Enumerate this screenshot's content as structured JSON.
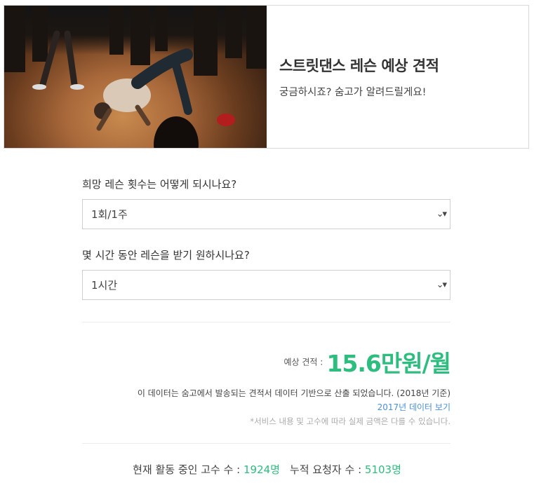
{
  "hero": {
    "title": "스트릿댄스 레슨 예상 견적",
    "subtitle": "궁금하시죠? 숨고가 알려드릴게요!"
  },
  "questions": [
    {
      "label": "희망 레슨 횟수는 어떻게 되시나요?",
      "selected": "1회/1주"
    },
    {
      "label": "몇 시간 동안 레슨을 받기 원하시나요?",
      "selected": "1시간"
    }
  ],
  "estimate": {
    "label": "예상 견적 :",
    "value": "15.6만원/월",
    "note": "이 데이터는 숨고에서 발송되는 견적서 데이터 기반으로 산출 되었습니다. (2018년 기준)",
    "link": "2017년 데이터 보기",
    "disclaimer": "*서비스 내용 및 고수에 따라 실제 금액은 다를 수 있습니다."
  },
  "stats": {
    "active_label": "현재 활동 중인 고수 수 : ",
    "active_value": "1924명",
    "requests_label": "누적 요청자 수 : ",
    "requests_value": "5103명"
  },
  "colors": {
    "accent": "#2dbd7e",
    "link": "#4a90d9"
  }
}
